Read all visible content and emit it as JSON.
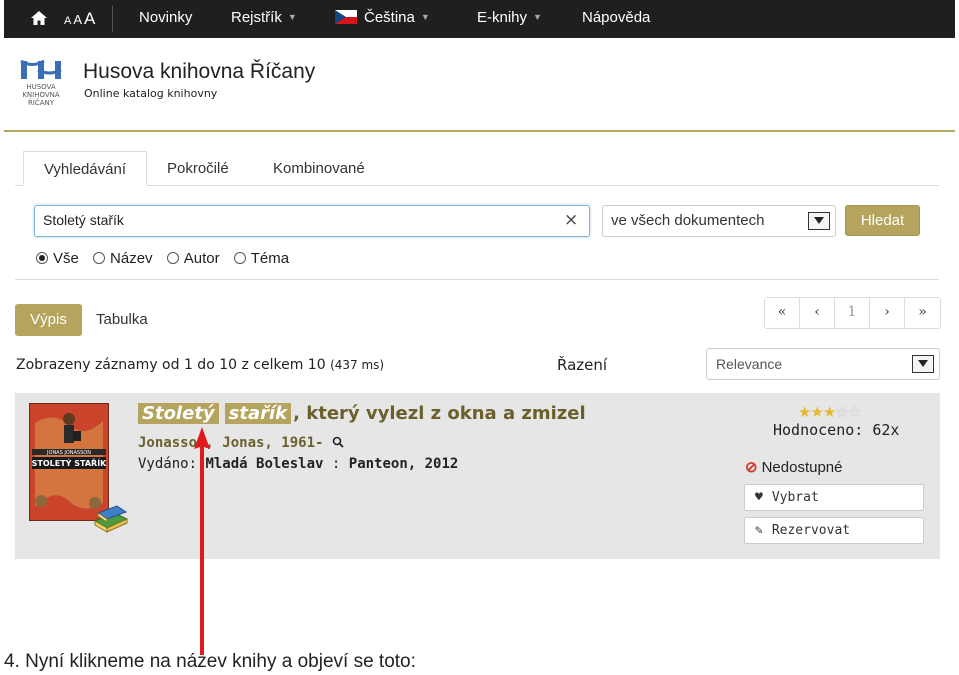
{
  "topnav": {
    "font_small": "A",
    "font_medium": "A",
    "font_large": "A",
    "items": [
      {
        "label": "Novinky"
      },
      {
        "label": "Rejstřík"
      },
      {
        "label": "Čeština"
      },
      {
        "label": "E-knihy"
      },
      {
        "label": "Nápověda"
      }
    ]
  },
  "header": {
    "title": "Husova knihovna Říčany",
    "subtitle": "Online katalog knihovny"
  },
  "tabs": [
    {
      "label": "Vyhledávání",
      "active": true
    },
    {
      "label": "Pokročilé"
    },
    {
      "label": "Kombinované"
    }
  ],
  "search": {
    "value": "Stoletý stařík",
    "clear": "×",
    "scope": "ve všech dokumentech",
    "button": "Hledat"
  },
  "search_fields": [
    {
      "label": "Vše",
      "selected": true
    },
    {
      "label": "Název"
    },
    {
      "label": "Autor"
    },
    {
      "label": "Téma"
    }
  ],
  "view": {
    "list": "Výpis",
    "table": "Tabulka"
  },
  "pager": {
    "first": "«",
    "prev": "‹",
    "page": "1",
    "next": "›",
    "last": "»"
  },
  "results": {
    "info": "Zobrazeny záznamy od 1 do 10 z celkem 10",
    "time": "(437 ms)",
    "sort_label": "Řazení",
    "sort_value": "Relevance"
  },
  "record": {
    "title_hl1": "Stoletý",
    "title_hl2": "stařík",
    "title_rest": ", který vylezl z okna a zmizel",
    "author": "Jonasson, Jonas, 1961-",
    "published_label": "Vydáno:",
    "published_place": "Mladá Boleslav",
    "published_sep": " : ",
    "published_pub": "Panteon, 2012",
    "rating": 3,
    "rating_max": 5,
    "rated": "Hodnoceno: 62x",
    "availability": "Nedostupné",
    "select_btn": "Vybrat",
    "reserve_btn": "Rezervovat",
    "cover_text_top": "JONAS JONASSON",
    "cover_text_title": "STOLETÝ STAŘÍK"
  },
  "caption": "4. Nyní klikneme na název knihy a objeví se toto:",
  "colors": {
    "accent": "#b5a45d",
    "topbar": "#1f1f1f",
    "annotation_arrow": "#e0191c",
    "unavailable": "#d9332b"
  },
  "icons": [
    "home-icon",
    "flag-cz-icon",
    "magnifier-icon",
    "ban-icon",
    "heart-icon",
    "pencil-icon",
    "book-stack-icon"
  ]
}
